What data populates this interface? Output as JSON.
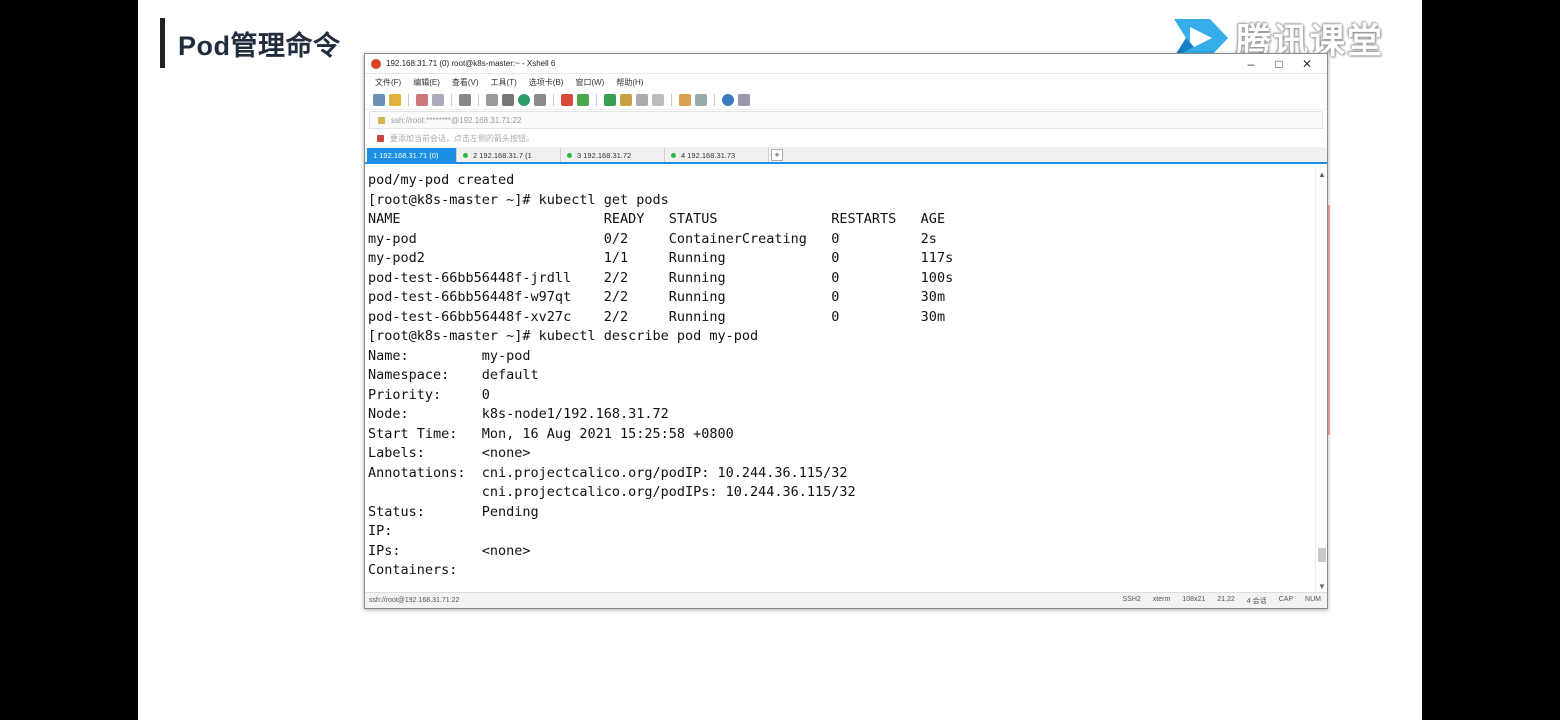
{
  "slide": {
    "title": "Pod管理命令",
    "logo_text": "腾讯课堂"
  },
  "window": {
    "title": "192.168.31.71 (0)  root@k8s-master:~  - Xshell 6",
    "controls": {
      "minimize": "–",
      "maximize": "□",
      "close": "✕"
    }
  },
  "menu": [
    "文件(F)",
    "编辑(E)",
    "查看(V)",
    "工具(T)",
    "选项卡(B)",
    "窗口(W)",
    "帮助(H)"
  ],
  "address": {
    "value": "ssh://root:********@192.168.31.71:22"
  },
  "hint": {
    "text": "要添加当前会话，点击左侧的箭头按钮。"
  },
  "tabs": [
    {
      "label": "1 192.168.31.71 (0)",
      "active": true
    },
    {
      "label": "2 192.168.31.7  (1",
      "active": false
    },
    {
      "label": "3 192.168.31.72",
      "active": false
    },
    {
      "label": "4 192.168.31.73",
      "active": false
    }
  ],
  "tab_add": "+",
  "terminal": {
    "lines": [
      "pod/my-pod created",
      "[root@k8s-master ~]# kubectl get pods",
      "NAME                         READY   STATUS              RESTARTS   AGE",
      "my-pod                       0/2     ContainerCreating   0          2s",
      "my-pod2                      1/1     Running             0          117s",
      "pod-test-66bb56448f-jrdll    2/2     Running             0          100s",
      "pod-test-66bb56448f-w97qt    2/2     Running             0          30m",
      "pod-test-66bb56448f-xv27c    2/2     Running             0          30m",
      "[root@k8s-master ~]# kubectl describe pod my-pod",
      "Name:         my-pod",
      "Namespace:    default",
      "Priority:     0",
      "Node:         k8s-node1/192.168.31.72",
      "Start Time:   Mon, 16 Aug 2021 15:25:58 +0800",
      "Labels:       <none>",
      "Annotations:  cni.projectcalico.org/podIP: 10.244.36.115/32",
      "              cni.projectcalico.org/podIPs: 10.244.36.115/32",
      "Status:       Pending",
      "IP:",
      "IPs:          <none>",
      "Containers:"
    ]
  },
  "status": {
    "left": "ssh://root@192.168.31.71:22",
    "right": [
      "SSH2",
      "xterm",
      "108x21",
      "21,22",
      "4 会话",
      "CAP",
      "NUM"
    ]
  },
  "colors": {
    "tab_active": "#1c8fe3",
    "title_accent": "#222222"
  }
}
